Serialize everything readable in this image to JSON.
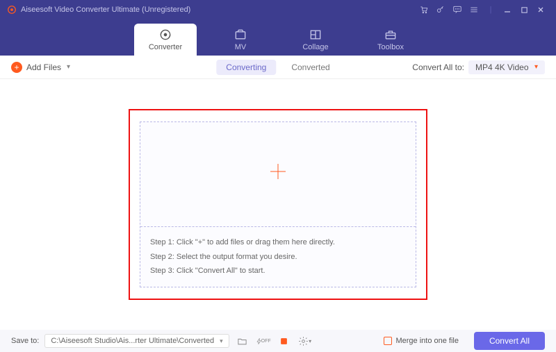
{
  "title": "Aiseesoft Video Converter Ultimate (Unregistered)",
  "tabs": {
    "converter": "Converter",
    "mv": "MV",
    "collage": "Collage",
    "toolbox": "Toolbox"
  },
  "toolbar": {
    "add_files": "Add Files",
    "seg_converting": "Converting",
    "seg_converted": "Converted",
    "convert_all_to": "Convert All to:",
    "format": "MP4 4K Video"
  },
  "steps": {
    "s1": "Step 1: Click \"+\" to add files or drag them here directly.",
    "s2": "Step 2: Select the output format you desire.",
    "s3": "Step 3: Click \"Convert All\" to start."
  },
  "bottom": {
    "save_to": "Save to:",
    "path": "C:\\Aiseesoft Studio\\Ais...rter Ultimate\\Converted",
    "merge": "Merge into one file",
    "convert_all": "Convert All"
  }
}
